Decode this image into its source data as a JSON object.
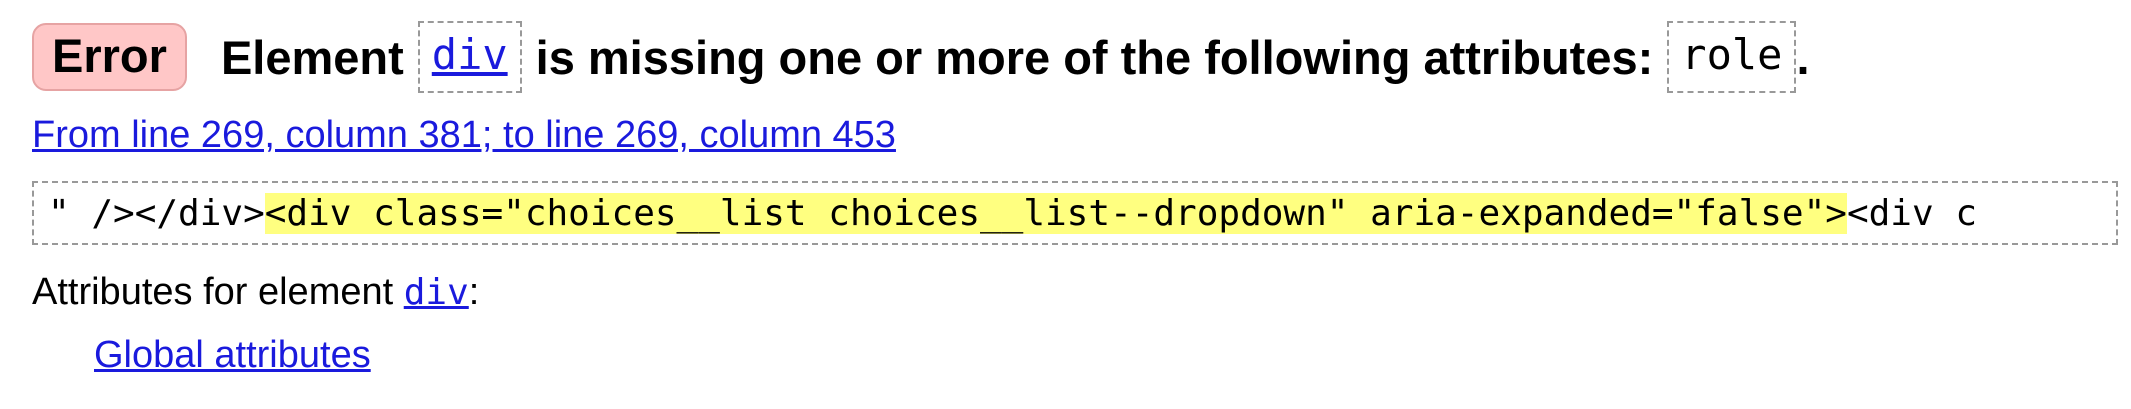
{
  "message": {
    "severity": "Error",
    "text_prefix": "Element",
    "element_name": "div",
    "text_middle": "is missing one or more of the following attributes:",
    "attribute_name": "role",
    "text_suffix": "."
  },
  "location": {
    "text": "From line 269, column 381; to line 269, column 453"
  },
  "extract": {
    "before": "\" /></div>",
    "highlighted": "<div class=\"choices__list choices__list--dropdown\" aria-expanded=\"false\">",
    "after": "<div c"
  },
  "attributes": {
    "label_prefix": "Attributes for element",
    "element_name": "div",
    "label_suffix": ":",
    "global_link": "Global attributes"
  },
  "colors": {
    "error_badge_bg": "#ffc7c7",
    "link": "#1a1add",
    "highlight": "#ffff80"
  }
}
